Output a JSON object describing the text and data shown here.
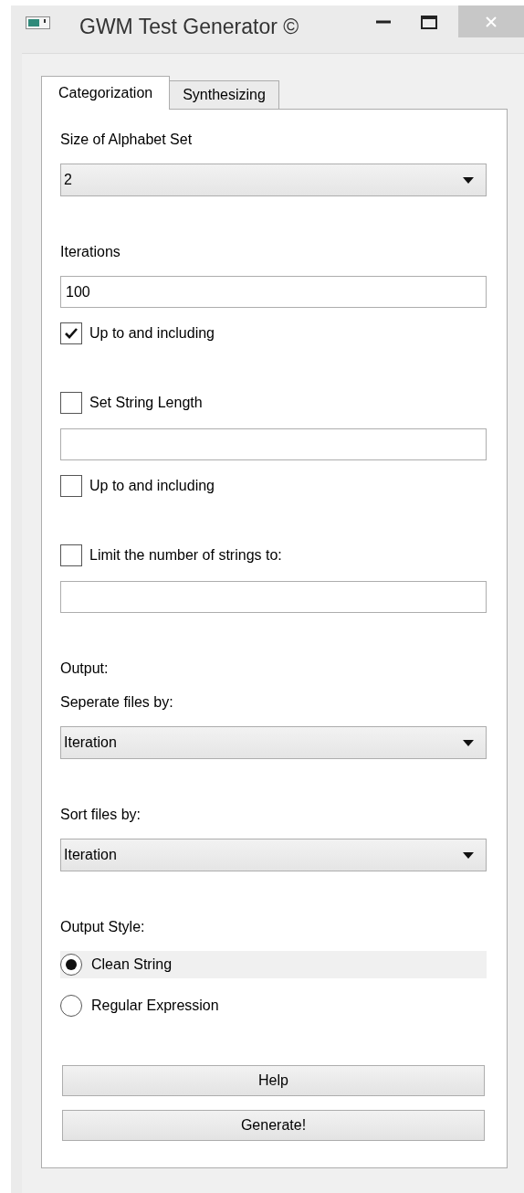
{
  "window": {
    "title": "GWM Test Generator ©"
  },
  "tabs": [
    {
      "label": "Categorization",
      "selected": true
    },
    {
      "label": "Synthesizing",
      "selected": false
    }
  ],
  "sections": [
    {
      "items": [
        {
          "kind": "label",
          "text": "Size of Alphabet Set"
        },
        {
          "kind": "combo",
          "value": "2"
        }
      ]
    },
    {
      "items": [
        {
          "kind": "label",
          "text": "Iterations"
        },
        {
          "kind": "field",
          "value": "100"
        },
        {
          "kind": "checkbox",
          "label": "Up to and including",
          "checked": true
        }
      ]
    },
    {
      "items": [
        {
          "kind": "checkbox",
          "label": "Set String Length",
          "checked": false
        },
        {
          "kind": "field"
        },
        {
          "kind": "checkbox",
          "label": "Up to and including",
          "checked": false
        }
      ]
    },
    {
      "items": [
        {
          "kind": "checkbox",
          "label": "Limit the number of strings to:",
          "checked": false
        },
        {
          "kind": "field"
        }
      ]
    },
    {
      "items": [
        {
          "kind": "label",
          "text": "Output:"
        },
        {
          "kind": "label",
          "text": "Seperate files by:"
        },
        {
          "kind": "combo",
          "value": "Iteration"
        }
      ]
    },
    {
      "items": [
        {
          "kind": "label",
          "text": "Sort files by:"
        },
        {
          "kind": "combo",
          "value": "Iteration"
        }
      ]
    },
    {
      "items": [
        {
          "kind": "label",
          "text": "Output Style:"
        },
        {
          "kind": "radio",
          "label": "Clean String",
          "selected": true,
          "focused": true
        },
        {
          "kind": "radio",
          "label": "Regular Expression",
          "selected": false,
          "focused": false
        }
      ]
    },
    {
      "items": [
        {
          "kind": "button",
          "label": "Help"
        },
        {
          "kind": "button",
          "label": "Generate!"
        }
      ]
    }
  ]
}
